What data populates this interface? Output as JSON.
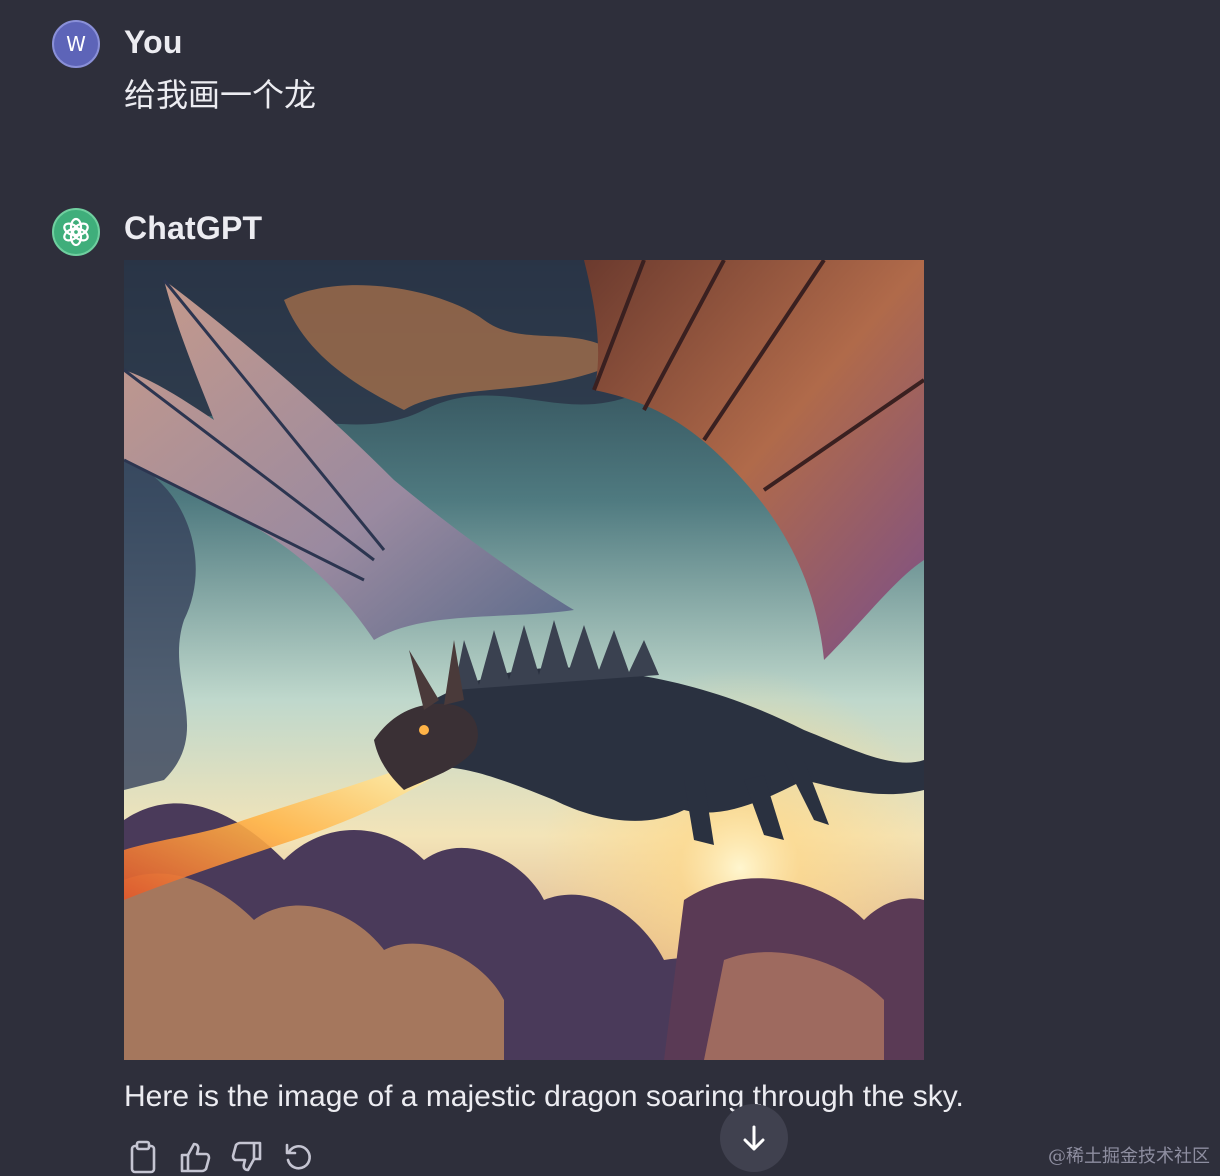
{
  "user_message": {
    "avatar_letter": "W",
    "author": "You",
    "text": "给我画一个龙"
  },
  "assistant_message": {
    "author": "ChatGPT",
    "avatar_icon": "openai-logo-icon",
    "image_alt": "dragon",
    "text": "Here is the image of a majestic dragon soaring through the sky."
  },
  "actions": [
    {
      "name": "copy-button",
      "icon": "clipboard-icon"
    },
    {
      "name": "thumbs-up-button",
      "icon": "thumbs-up-icon"
    },
    {
      "name": "thumbs-down-button",
      "icon": "thumbs-down-icon"
    },
    {
      "name": "regenerate-button",
      "icon": "refresh-icon"
    }
  ],
  "scroll_button": {
    "icon": "arrow-down-icon"
  },
  "watermark": "@稀土掘金技术社区",
  "colors": {
    "background": "#2e2f3b",
    "user_avatar": "#5d64b8",
    "gpt_avatar": "#3fae7b",
    "text": "#ececf1"
  }
}
